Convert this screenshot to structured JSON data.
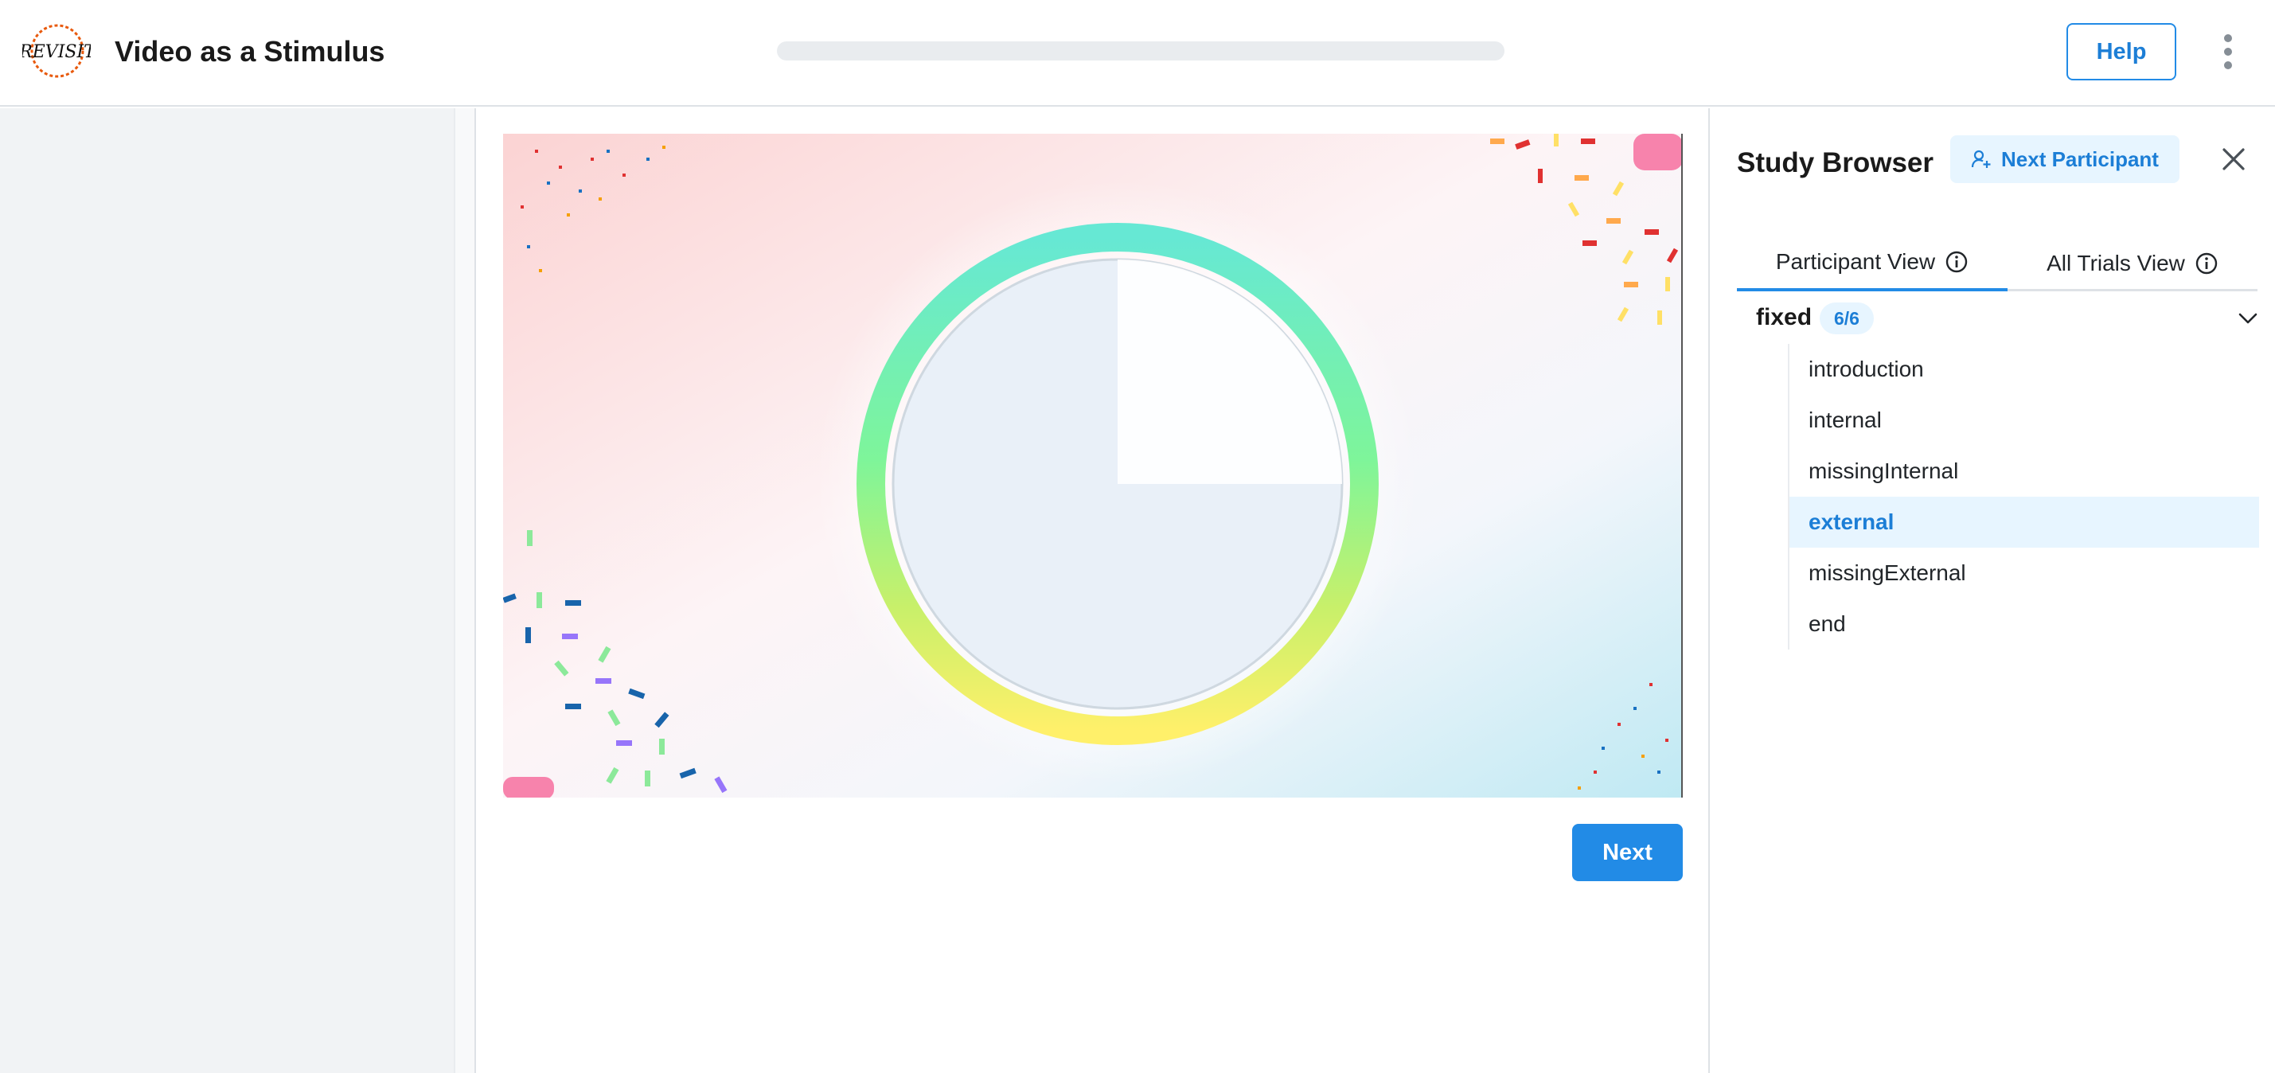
{
  "header": {
    "logo_text": "REVISIT",
    "title": "Video as a Stimulus",
    "progress": 0,
    "help_label": "Help",
    "menu_icon": "kebab-menu-icon"
  },
  "main": {
    "next_label": "Next"
  },
  "study_browser": {
    "title": "Study Browser",
    "next_participant_label": "Next Participant",
    "close_icon": "close-icon",
    "tabs": [
      {
        "label": "Participant View",
        "active": true
      },
      {
        "label": "All Trials View",
        "active": false
      }
    ],
    "group": {
      "name": "fixed",
      "badge": "6/6",
      "trials": [
        {
          "label": "introduction",
          "active": false
        },
        {
          "label": "internal",
          "active": false
        },
        {
          "label": "missingInternal",
          "active": false
        },
        {
          "label": "external",
          "active": true
        },
        {
          "label": "missingExternal",
          "active": false
        },
        {
          "label": "end",
          "active": false
        }
      ]
    }
  },
  "colors": {
    "accent": "#228be6",
    "accent_light": "#e7f5ff",
    "progress_track": "#e9ecef",
    "sidebar_bg": "#f1f3f5"
  }
}
